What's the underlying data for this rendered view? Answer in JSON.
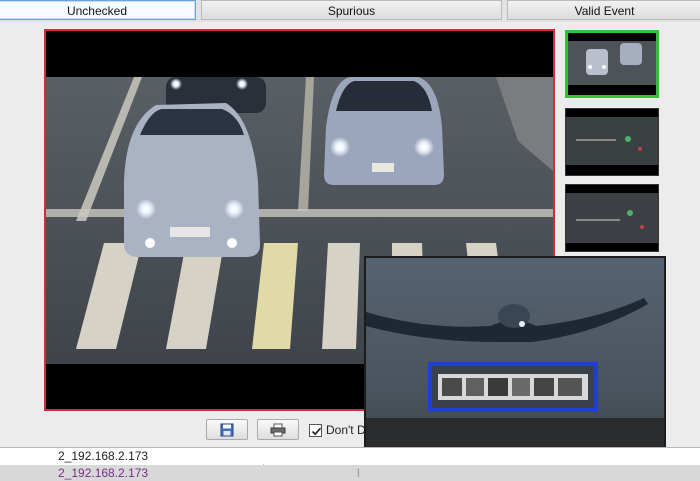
{
  "tabs": [
    {
      "label": "Unchecked",
      "active": true
    },
    {
      "label": "Spurious",
      "active": false
    },
    {
      "label": "Valid Event",
      "active": false
    }
  ],
  "main_image": {
    "alt": "traffic camera night view of cars at crosswalk"
  },
  "thumbnails": [
    {
      "alt": "thumbnail 1 selected"
    },
    {
      "alt": "thumbnail 2"
    },
    {
      "alt": "thumbnail 3"
    }
  ],
  "plate_zoom": {
    "alt": "zoomed license plate (pixelated)"
  },
  "toolbar": {
    "save_icon": "save-icon",
    "print_icon": "print-icon",
    "dont_label": "Don't D",
    "dont_checked": true
  },
  "table": {
    "rows": [
      {
        "source": "2_192.168.2.173",
        "extra": ""
      },
      {
        "source": "2_192.168.2.173",
        "extra": "l"
      }
    ]
  },
  "colors": {
    "selected_border": "#d8283a",
    "thumb_selected": "#34c23a",
    "plate_box": "#1e3fd6"
  }
}
